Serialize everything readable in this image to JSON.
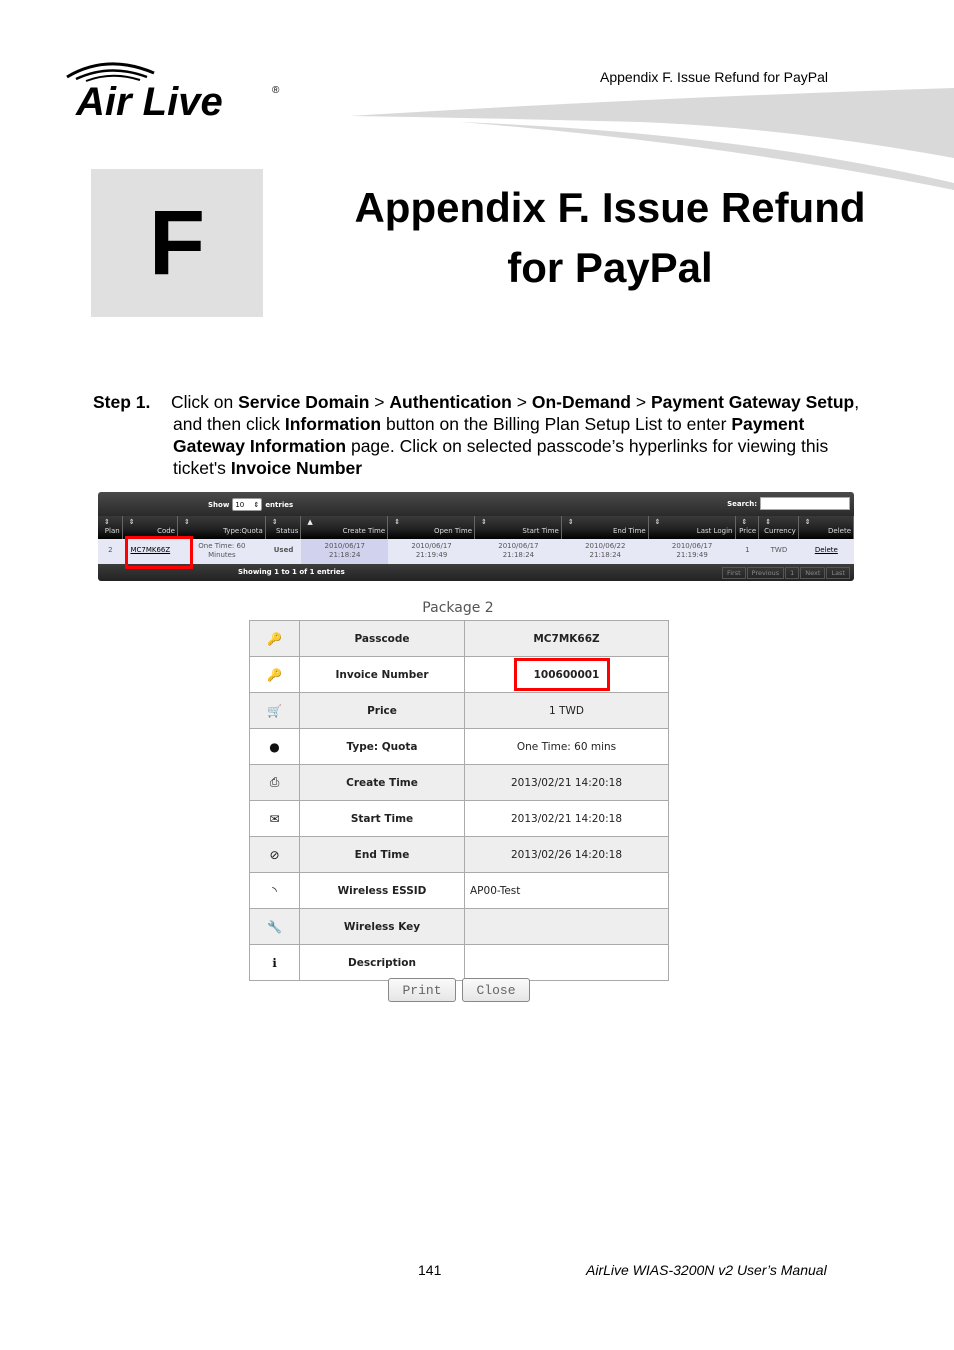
{
  "header": {
    "running_title": "Appendix F. Issue Refund for PayPal",
    "logo_text": "Air Live",
    "logo_mark": "®"
  },
  "chapter": {
    "letter": "F",
    "title_line1": "Appendix F. Issue Refund",
    "title_line2": "for PayPal"
  },
  "step": {
    "label": "Step 1.",
    "parts": [
      {
        "t": "Click on ",
        "b": false
      },
      {
        "t": "Service Domain",
        "b": true
      },
      {
        "t": " > ",
        "b": false
      },
      {
        "t": "Authentication",
        "b": true
      },
      {
        "t": " > ",
        "b": false
      },
      {
        "t": "On-Demand",
        "b": true
      },
      {
        "t": " > ",
        "b": false
      },
      {
        "t": "Payment Gateway Setup",
        "b": true
      },
      {
        "t": ", and then click ",
        "b": false
      },
      {
        "t": "Information",
        "b": true
      },
      {
        "t": " button on the Billing Plan Setup List to enter ",
        "b": false
      },
      {
        "t": "Payment Gateway Information",
        "b": true
      },
      {
        "t": " page. Click on selected passcode’s hyperlinks for viewing this ticket's ",
        "b": false
      },
      {
        "t": "Invoice Number",
        "b": true
      }
    ]
  },
  "grid": {
    "show_label": "Show",
    "show_value": "10",
    "entries_label": "entries",
    "search_label": "Search:",
    "search_value": "",
    "columns": [
      "Plan",
      "Code",
      "Type:Quota",
      "Status",
      "Create Time",
      "Open Time",
      "Start Time",
      "End Time",
      "Last Login",
      "Price",
      "Currency",
      "Delete"
    ],
    "sorted_column": "Create Time",
    "rows": [
      {
        "plan": "2",
        "code": "MC7MK66Z",
        "type_quota": [
          "One Time: 60",
          "Minutes"
        ],
        "status": "Used",
        "create_time": [
          "2010/06/17",
          "21:18:24"
        ],
        "open_time": [
          "2010/06/17",
          "21:19:49"
        ],
        "start_time": [
          "2010/06/17",
          "21:18:24"
        ],
        "end_time": [
          "2010/06/22",
          "21:18:24"
        ],
        "last_login": [
          "2010/06/17",
          "21:19:49"
        ],
        "price": "1",
        "currency": "TWD",
        "delete": "Delete"
      }
    ],
    "footer_info": "Showing 1 to 1 of 1 entries",
    "pager": [
      "First",
      "Previous",
      "1",
      "Next",
      "Last"
    ]
  },
  "detail": {
    "title": "Package 2",
    "rows": [
      {
        "icon": "key-icon",
        "glyph": "🔑",
        "label": "Passcode",
        "value": "MC7MK66Z"
      },
      {
        "icon": "key-icon",
        "glyph": "🔑",
        "label": "Invoice Number",
        "value": "100600001"
      },
      {
        "icon": "cart-icon",
        "glyph": "🛒",
        "label": "Price",
        "value": "1 TWD"
      },
      {
        "icon": "clock-icon",
        "glyph": "●",
        "label": "Type: Quota",
        "value": "One Time: 60 mins"
      },
      {
        "icon": "printer-icon",
        "glyph": "⎙",
        "label": "Create Time",
        "value": "2013/02/21 14:20:18"
      },
      {
        "icon": "envelope-icon",
        "glyph": "✉",
        "label": "Start Time",
        "value": "2013/02/21 14:20:18"
      },
      {
        "icon": "cancel-icon",
        "glyph": "⊘",
        "label": "End Time",
        "value": "2013/02/26 14:20:18"
      },
      {
        "icon": "wifi-icon",
        "glyph": "◝",
        "label": "Wireless ESSID",
        "value": "AP00-Test"
      },
      {
        "icon": "wrench-icon",
        "glyph": "🔧",
        "label": "Wireless Key",
        "value": ""
      },
      {
        "icon": "info-icon",
        "glyph": "ℹ",
        "label": "Description",
        "value": ""
      }
    ],
    "print_label": "Print",
    "close_label": "Close"
  },
  "footer": {
    "page_number": "141",
    "manual_title": "AirLive WIAS-3200N v2 User’s Manual"
  },
  "colors": {
    "highlight_box": "#ff0000",
    "chapter_box": "#e0e0e0",
    "grid_row": "#e6e8f6"
  }
}
